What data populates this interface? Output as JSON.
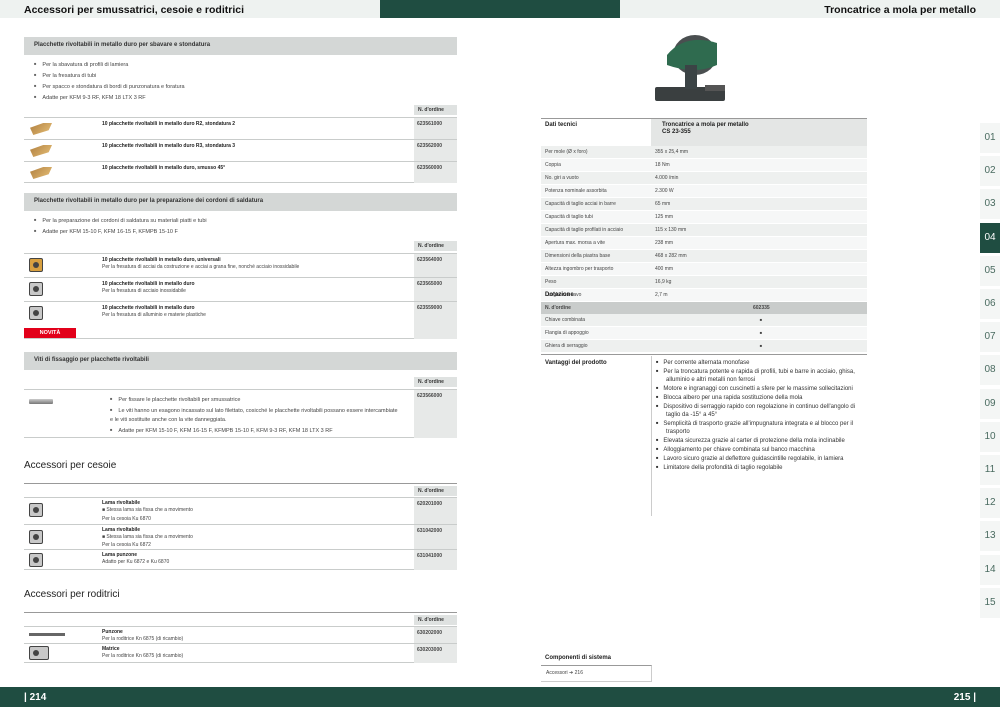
{
  "header": {
    "left_title": "Accessori per smussatrici, cesoie e roditrici",
    "right_title": "Troncatrice a mola per metallo"
  },
  "col_order": "N. d'ordine",
  "section1": {
    "title": "Placchette rivoltabili in metallo duro per sbavare e stondatura",
    "bullets": [
      "Per la sbavatura di profili di lamiera",
      "Per la fresatura di tubi",
      "Per spacco e stondatura di bordi di punzonatura e foratura",
      "Adatte per KFM 9-3 RF, KFM 18 LTX 3 RF"
    ],
    "rows": [
      {
        "name": "10 placchette rivoltabili in metallo duro R2, stondatura 2",
        "order": "623561000"
      },
      {
        "name": "10 placchette rivoltabili in metallo duro R3, stondatura 3",
        "order": "623562000"
      },
      {
        "name": "10 placchette rivoltabili in metallo duro, smusso 45°",
        "order": "623560000"
      }
    ]
  },
  "section2": {
    "title": "Placchette rivoltabili in metallo duro per la preparazione dei cordoni di saldatura",
    "bullets": [
      "Per la preparazione dei cordoni di saldatura su materiali piatti e tubi",
      "Adatte per KFM 15-10 F, KFM 16-15 F, KFMPB 15-10 F"
    ],
    "rows": [
      {
        "name": "10 placchette rivoltabili in metallo duro, universali",
        "desc": "Per la fresatura di acciai da costruzione e acciai a grana fine, nonché acciaio inossidabile",
        "order": "623564000"
      },
      {
        "name": "10 placchette rivoltabili in metallo duro",
        "desc": "Per la fresatura di acciaio inossidabile",
        "order": "623565000"
      },
      {
        "name": "10 placchette rivoltabili in metallo duro",
        "desc": "Per la fresatura di alluminio e materie plastiche",
        "order": "623559000"
      }
    ],
    "badge": "NOVITÀ"
  },
  "section3": {
    "title": "Viti di fissaggio per placchette rivoltabili",
    "bullets": [
      "Per fissare le placchette rivoltabili per smussatrice",
      "Le viti hanno un esagono incassato sul lato filettato, cosicché le placchette rivoltabili possano essere intercambiate e le viti sostituite anche con la vite danneggiata.",
      "Adatte per KFM 15-10 F, KFM 16-15 F, KFMPB 15-10 F, KFM 9-3 RF, KFM 18 LTX 3 RF"
    ],
    "order": "623566000"
  },
  "cesoie": {
    "title": "Accessori per cesoie",
    "rows": [
      {
        "name": "Lama rivoltabile",
        "bullet": "Stessa lama sia fissa che a movimento",
        "desc": "Per la cesoia Ku 6870",
        "order": "620201000"
      },
      {
        "name": "Lama rivoltabile",
        "bullet": "Stessa lama sia fissa che a movimento",
        "desc": "Per la cesoia Ku 6872",
        "order": "631042000"
      },
      {
        "name": "Lama punzone",
        "desc": "Adatto per Ku 6872 e Ku 6870",
        "order": "631041000"
      }
    ]
  },
  "roditrici": {
    "title": "Accessori per roditrici",
    "rows": [
      {
        "name": "Punzone",
        "desc": "Per la roditrice Kn 6875 (di ricambio)",
        "order": "630202000"
      },
      {
        "name": "Matrice",
        "desc": "Per la roditrice Kn 6875 (di ricambio)",
        "order": "630203000"
      }
    ]
  },
  "specs": {
    "heading": "Dati tecnici",
    "product": "Troncatrice a mola per metallo",
    "model": "CS 23-355",
    "rows": [
      [
        "Per mole (Ø x foro)",
        "355 x 25,4 mm"
      ],
      [
        "Coppia",
        "18 Nm"
      ],
      [
        "No. giri a vuoto",
        "4.000 /min"
      ],
      [
        "Potenza nominale assorbita",
        "2.300 W"
      ],
      [
        "Capacità di taglio acciai in barre",
        "65 mm"
      ],
      [
        "Capacità di taglio tubi",
        "125 mm"
      ],
      [
        "Capacità di taglio profilati in acciaio",
        "115 x 130 mm"
      ],
      [
        "Apertura max. morsa a vite",
        "238 mm"
      ],
      [
        "Dimensioni della piastra base",
        "468 x 282 mm"
      ],
      [
        "Altezza ingombro per trasporto",
        "400 mm"
      ],
      [
        "Peso",
        "16,9 kg"
      ],
      [
        "Lunghezza cavo",
        "2,7 m"
      ]
    ]
  },
  "dotazione": {
    "heading": "Dotazione",
    "order_label": "N. d'ordine",
    "order": "602335",
    "mark": "■",
    "items": [
      "Chiave combinata",
      "Flangia di appoggio",
      "Ghiera di serraggio"
    ]
  },
  "vantaggi": {
    "heading": "Vantaggi del prodotto",
    "items": [
      "Per corrente alternata monofase",
      "Per la troncatura potente e rapida di profili, tubi e barre in acciaio, ghisa, alluminio e altri metalli non ferrosi",
      "Motore e ingranaggi con cuscinetti a sfere per le massime sollecitazioni",
      "Blocca albero per una rapida sostituzione della mola",
      "Dispositivo di serraggio rapido con regolazione in continuo dell'angolo di taglio da -15° a 45°",
      "Semplicità di trasporto grazie all'impugnatura integrata e al blocco per il trasporto",
      "Elevata sicurezza grazie al carter di protezione della mola inclinabile",
      "Alloggiamento per chiave combinata sul banco macchina",
      "Lavoro sicuro grazie al deflettore guidascintille regolabile, in lamiera",
      "Limitatore della profondità di taglio regolabile"
    ]
  },
  "componenti": {
    "heading": "Componenti di sistema",
    "text": "Accessori ➜ 216"
  },
  "tabs": [
    "01",
    "02",
    "03",
    "04",
    "05",
    "06",
    "07",
    "08",
    "09",
    "10",
    "11",
    "12",
    "13",
    "14",
    "15"
  ],
  "active_tab": "04",
  "footer": {
    "left": "| 214",
    "right": "215 |"
  },
  "colors": {
    "primary": "#1f4d41",
    "badge": "#e2001a"
  }
}
